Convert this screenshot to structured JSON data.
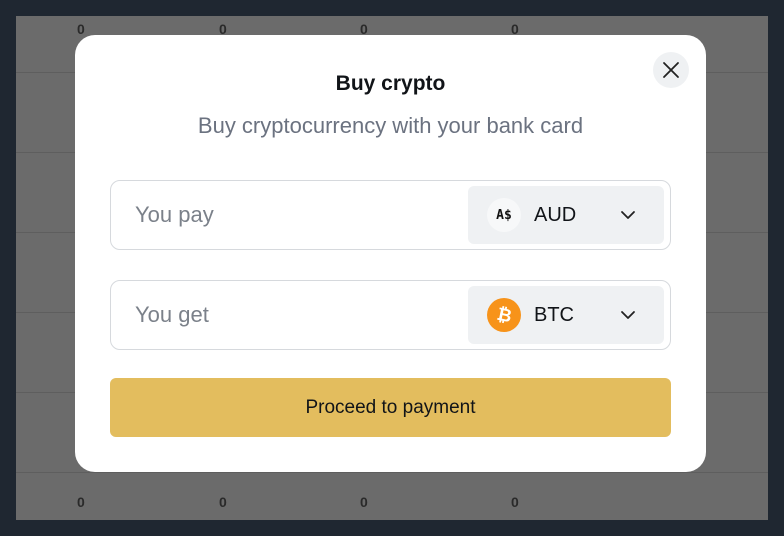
{
  "background_table": {
    "top_row_values": [
      "0",
      "0",
      "0",
      "0"
    ],
    "bottom_row_values": [
      "0",
      "0",
      "0",
      "0"
    ]
  },
  "modal": {
    "title": "Buy crypto",
    "subtitle": "Buy cryptocurrency with your bank card",
    "close_icon": "close-icon",
    "pay": {
      "placeholder": "You pay",
      "value": "",
      "currency_code": "AUD",
      "currency_icon_text": "A$"
    },
    "get": {
      "placeholder": "You get",
      "value": "",
      "currency_code": "BTC",
      "currency_icon_text": "₿"
    },
    "proceed_label": "Proceed to payment"
  },
  "colors": {
    "accent_button": "#e3bd5e",
    "btc_orange": "#f7931a",
    "backdrop": "#6b6b6b"
  }
}
